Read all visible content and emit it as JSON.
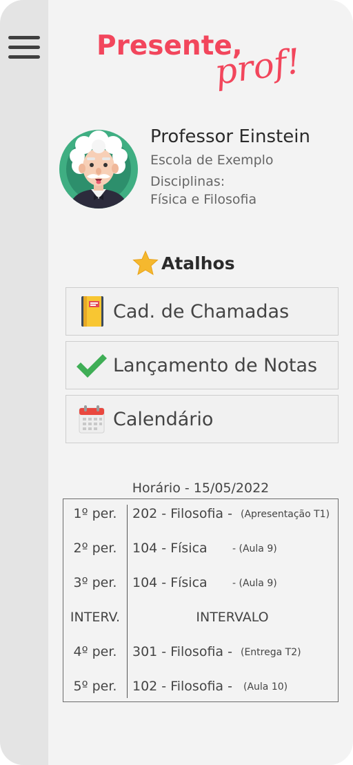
{
  "app": {
    "logo_line1": "Presente,",
    "logo_line2": "prof!",
    "accent_color": "#f2465c"
  },
  "menu": {
    "icon": "hamburger-menu-icon"
  },
  "profile": {
    "name": "Professor Einstein",
    "school": "Escola de Exemplo",
    "disciplines_label": "Disciplinas:",
    "disciplines": "Física e Filosofia",
    "avatar_icon": "einstein-avatar"
  },
  "shortcuts": {
    "title": "Atalhos",
    "title_icon": "star-icon",
    "items": [
      {
        "label": "Cad. de Chamadas",
        "icon": "notebook-icon"
      },
      {
        "label": "Lançamento de Notas",
        "icon": "checkmark-icon"
      },
      {
        "label": "Calendário",
        "icon": "calendar-icon"
      }
    ]
  },
  "schedule": {
    "title": "Horário - 15/05/2022",
    "rows": [
      {
        "period": "1º per.",
        "class": "202 - Filosofia -",
        "note": "(Apresentação T1)"
      },
      {
        "period": "2º per.",
        "class": "104 - Física",
        "note": "- (Aula 9)"
      },
      {
        "period": "3º per.",
        "class": "104 - Física",
        "note": "- (Aula 9)"
      },
      {
        "period": "INTERV.",
        "class": "INTERVALO",
        "note": ""
      },
      {
        "period": "4º per.",
        "class": "301 - Filosofia -",
        "note": "(Entrega T2)"
      },
      {
        "period": "5º per.",
        "class": "102 - Filosofia -",
        "note": "(Aula 10)"
      }
    ]
  }
}
